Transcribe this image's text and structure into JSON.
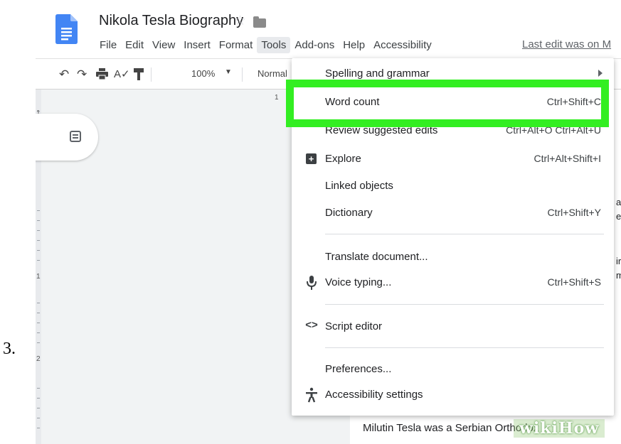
{
  "step_number": "3.",
  "app": {
    "doc_title": "Nikola Tesla Biography",
    "menu_items": [
      "File",
      "Edit",
      "View",
      "Insert",
      "Format",
      "Tools",
      "Add-ons",
      "Help",
      "Accessibility"
    ],
    "active_menu": "Tools",
    "last_edit": "Last edit was on M"
  },
  "toolbar": {
    "zoom": "100%",
    "style": "Normal",
    "icons": [
      "undo-icon",
      "redo-icon",
      "print-icon",
      "spellcheck-icon",
      "paint-format-icon"
    ]
  },
  "ruler": {
    "horizontal_label": "1",
    "vertical_labels": [
      "1",
      "1",
      "2"
    ]
  },
  "tools_menu": {
    "items": [
      {
        "label": "Spelling and grammar",
        "shortcut": "",
        "icon": "",
        "submenu": true
      },
      {
        "label": "Word count",
        "shortcut": "Ctrl+Shift+C",
        "icon": "",
        "highlighted": true
      },
      {
        "label": "Review suggested edits",
        "shortcut": "Ctrl+Alt+O Ctrl+Alt+U",
        "icon": ""
      },
      {
        "label": "Explore",
        "shortcut": "Ctrl+Alt+Shift+I",
        "icon": "explore-icon"
      },
      {
        "label": "Linked objects",
        "shortcut": "",
        "icon": ""
      },
      {
        "label": "Dictionary",
        "shortcut": "Ctrl+Shift+Y",
        "icon": ""
      },
      {
        "label": "Translate document...",
        "shortcut": "",
        "icon": ""
      },
      {
        "label": "Voice typing...",
        "shortcut": "Ctrl+Shift+S",
        "icon": "microphone-icon"
      },
      {
        "label": "Script editor",
        "shortcut": "",
        "icon": "code-icon"
      },
      {
        "label": "Preferences...",
        "shortcut": "",
        "icon": ""
      },
      {
        "label": "Accessibility settings",
        "shortcut": "",
        "icon": "accessibility-icon"
      }
    ],
    "highlight_color": "#33ee22"
  },
  "document": {
    "visible_line": "Milutin Tesla was a Serbian Orthodox"
  },
  "watermark": "wikiHow"
}
